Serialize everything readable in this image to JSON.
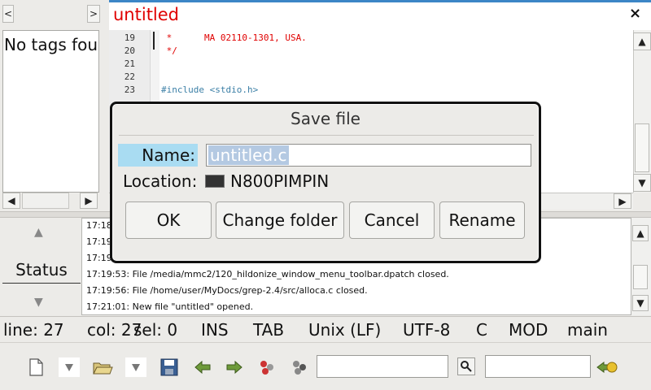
{
  "sidebar": {
    "nav_left": "<",
    "nav_right": ">",
    "empty_text": "No tags fou"
  },
  "editor": {
    "tab_title": "untitled",
    "close_label": "×",
    "lines": [
      {
        "num": "19",
        "text": " *      MA 02110-1301, USA.",
        "color": "#e00000"
      },
      {
        "num": "20",
        "text": " */",
        "color": "#e00000"
      },
      {
        "num": "21",
        "text": "",
        "color": "#000000"
      },
      {
        "num": "22",
        "text": "",
        "color": "#000000"
      },
      {
        "num": "23",
        "text": "#include <stdio.h>",
        "color": "#3b7fa6"
      }
    ]
  },
  "status_panel": {
    "label": "Status",
    "messages": [
      "17:18",
      "17:19",
      "17:19",
      "17:19:53: File /media/mmc2/120_hildonize_window_menu_toolbar.dpatch closed.",
      "17:19:56: File /home/user/MyDocs/grep-2.4/src/alloca.c closed.",
      "17:21:01: New file \"untitled\" opened."
    ]
  },
  "statusbar": {
    "line": "line: 27",
    "col": "col: 27",
    "sel": "sel: 0",
    "mode": "INS",
    "indent": "TAB",
    "eol": "Unix (LF)",
    "encoding": "UTF-8",
    "filetype": "C",
    "modified": "MOD",
    "scope": "main"
  },
  "dialog": {
    "title": "Save file",
    "name_label": "Name:",
    "name_value": "untitled.c",
    "location_label": "Location:",
    "location_value": "N800PIMPIN",
    "buttons": {
      "ok": "OK",
      "change_folder": "Change folder",
      "cancel": "Cancel",
      "rename": "Rename"
    }
  },
  "toolbar": {
    "icons": [
      "new-file-icon",
      "dropdown-icon",
      "open-folder-icon",
      "dropdown-icon",
      "save-icon",
      "back-icon",
      "forward-icon",
      "compile-icon",
      "build-icon",
      "search-icon",
      "goto-icon"
    ]
  },
  "colors": {
    "accent": "#3c86c6",
    "title_red": "#e00000",
    "label_highlight": "#a9dcf2"
  }
}
